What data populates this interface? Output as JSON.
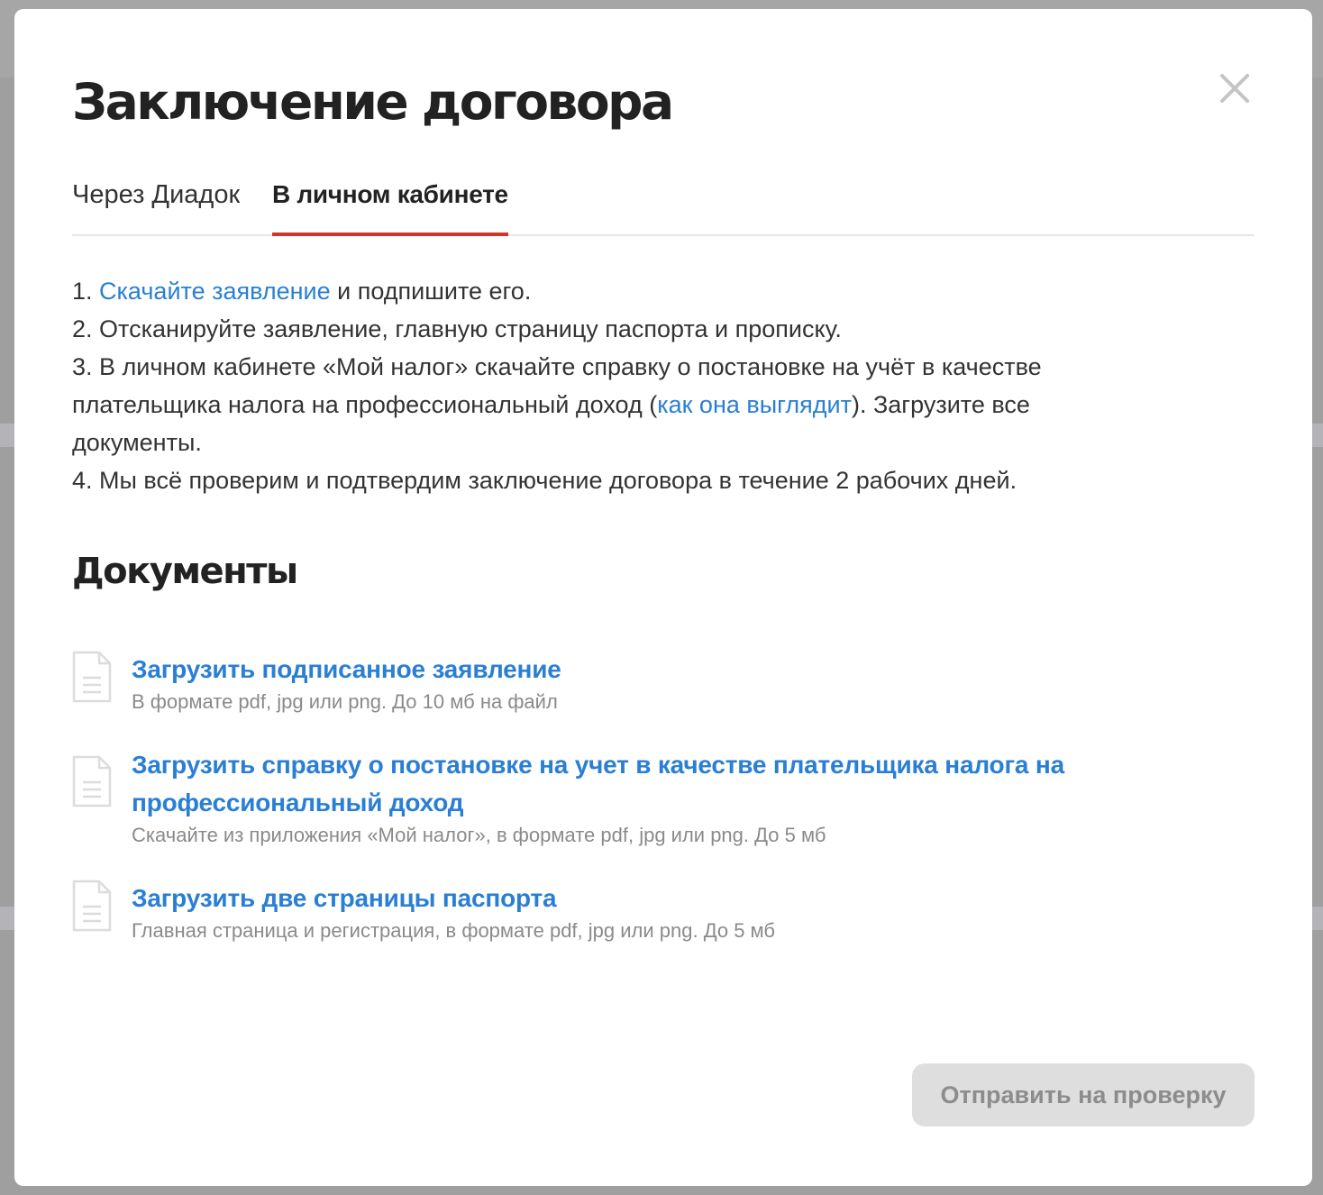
{
  "modal": {
    "title": "Заключение договора",
    "close_icon": "close-icon"
  },
  "tabs": [
    {
      "label": "Через Диадок",
      "active": false
    },
    {
      "label": "В личном кабинете",
      "active": true
    }
  ],
  "colors": {
    "accent": "#d23228",
    "link": "#2a7fd4",
    "text": "#333333",
    "hint": "#8a8a8a",
    "disabled_button_bg": "#dedede"
  },
  "instructions": {
    "step1_prefix": "1. ",
    "step1_link": "Скачайте заявление",
    "step1_suffix": " и подпишите его.",
    "step2": "2. Отсканируйте заявление, главную страницу паспорта и прописку.",
    "step3_line1": "3. В личном кабинете «Мой налог» скачайте справку о постановке на учёт в качестве",
    "step3_line2_prefix": "плательщика налога на профессиональный доход (",
    "step3_link": "как она выглядит",
    "step3_line2_suffix": "). Загрузите все",
    "step3_line3": "документы.",
    "step4": "4. Мы всё проверим и подтвердим заключение договора в течение 2 рабочих дней."
  },
  "documents": {
    "title": "Документы",
    "items": [
      {
        "icon": "document-icon",
        "link": "Загрузить подписанное заявление",
        "hint": "В формате pdf, jpg или png. До 10 мб на файл"
      },
      {
        "icon": "document-icon",
        "link_line1": "Загрузить справку о постановке на учет в качестве плательщика налога на",
        "link_line2": "профессиональный доход",
        "hint": "Скачайте из приложения «Мой налог», в формате pdf, jpg или png. До 5 мб"
      },
      {
        "icon": "document-icon",
        "link": "Загрузить две страницы паспорта",
        "hint": "Главная страница и регистрация, в формате pdf, jpg или png. До 5 мб"
      }
    ]
  },
  "submit": {
    "label": "Отправить на проверку",
    "disabled": true
  }
}
